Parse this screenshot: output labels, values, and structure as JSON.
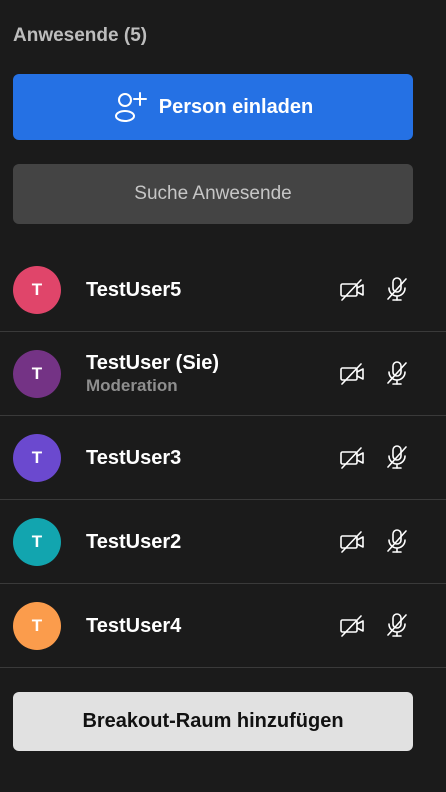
{
  "panel": {
    "title": "Anwesende (5)"
  },
  "invite_button": {
    "label": "Person einladen",
    "icon": "add-person-icon",
    "color": "#2571e4"
  },
  "search": {
    "placeholder": "Suche Anwesende",
    "value": ""
  },
  "participants": [
    {
      "initial": "T",
      "name": "TestUser5",
      "role": "",
      "avatar_color": "#e0456a",
      "camera": "camera-off-icon",
      "mic": "mic-off-icon"
    },
    {
      "initial": "T",
      "name": "TestUser (Sie)",
      "role": "Moderation",
      "avatar_color": "#743385",
      "camera": "camera-off-icon",
      "mic": "mic-off-icon"
    },
    {
      "initial": "T",
      "name": "TestUser3",
      "role": "",
      "avatar_color": "#6b49cf",
      "camera": "camera-off-icon",
      "mic": "mic-off-icon"
    },
    {
      "initial": "T",
      "name": "TestUser2",
      "role": "",
      "avatar_color": "#12a5af",
      "camera": "camera-off-icon",
      "mic": "mic-off-icon"
    },
    {
      "initial": "T",
      "name": "TestUser4",
      "role": "",
      "avatar_color": "#fb9c4c",
      "camera": "camera-off-icon",
      "mic": "mic-off-icon"
    }
  ],
  "breakout_button": {
    "label": "Breakout-Raum hinzufügen"
  }
}
